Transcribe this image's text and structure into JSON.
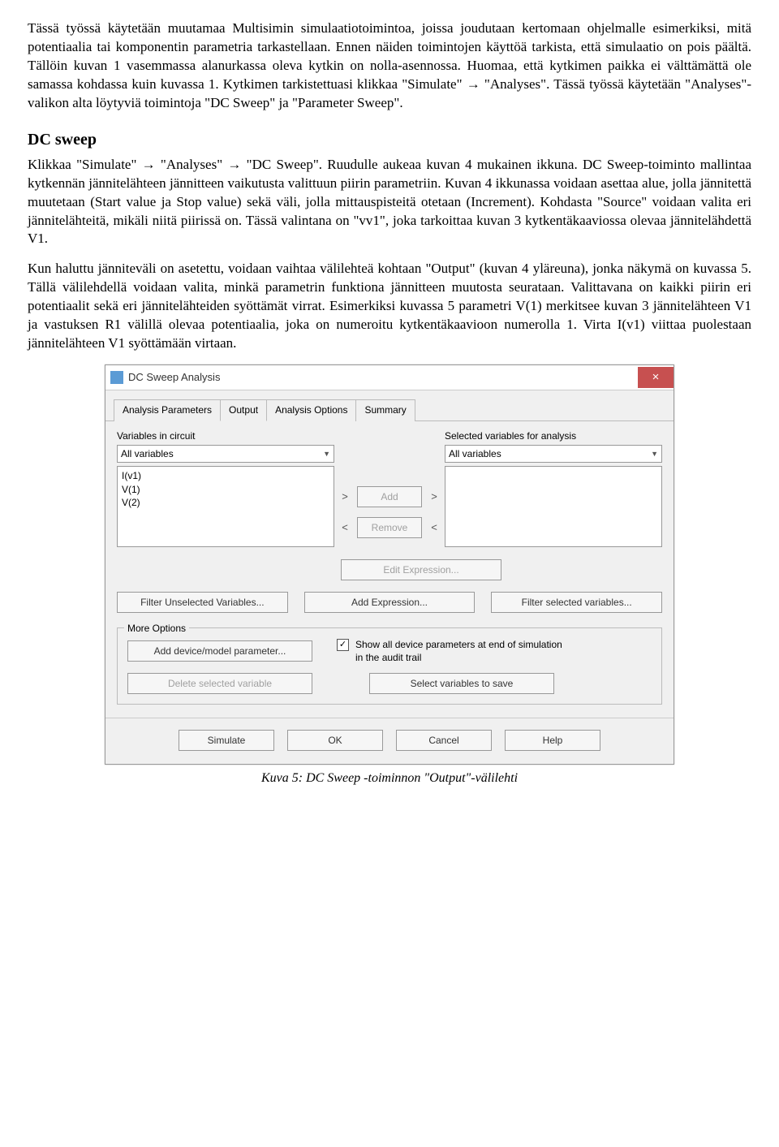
{
  "para1": "Tässä työssä käytetään muutamaa Multisimin simulaatiotoimintoa, joissa joudutaan kertomaan ohjelmalle esimerkiksi, mitä potentiaalia tai komponentin parametria tarkastellaan. Ennen näiden toimintojen käyttöä tarkista, että simulaatio on pois päältä. Tällöin kuvan 1 vasemmassa alanurkassa oleva kytkin on nolla-asennossa. Huomaa, että kytkimen paikka ei välttämättä ole samassa kohdassa kuin kuvassa 1. Kytkimen tarkistettuasi klikkaa \"Simulate\" → \"Analyses\". Tässä työssä käytetään \"Analyses\"-valikon alta löytyviä toimintoja \"DC Sweep\" ja \"Parameter Sweep\".",
  "h_dc": "DC sweep",
  "para2": "Klikkaa \"Simulate\" → \"Analyses\" → \"DC Sweep\". Ruudulle aukeaa kuvan 4 mukainen ikkuna. DC Sweep-toiminto mallintaa kytkennän jännitelähteen jännitteen vaikutusta valittuun piirin parametriin. Kuvan 4 ikkunassa voidaan asettaa alue, jolla jännitettä muutetaan (Start value ja Stop value) sekä väli, jolla mittauspisteitä otetaan (Increment). Kohdasta \"Source\" voidaan valita eri jännitelähteitä, mikäli niitä piirissä on. Tässä valintana on \"vv1\", joka tarkoittaa kuvan 3 kytkentäkaaviossa olevaa jännitelähdettä V1.",
  "para3": "Kun haluttu jänniteväli on asetettu, voidaan vaihtaa välilehteä kohtaan \"Output\" (kuvan 4 yläreuna), jonka näkymä on kuvassa 5. Tällä välilehdellä voidaan valita, minkä parametrin funktiona jännitteen muutosta seurataan. Valittavana on kaikki piirin eri potentiaalit sekä eri jännitelähteiden syöttämät virrat. Esimerkiksi kuvassa 5 parametri V(1) merkitsee kuvan 3 jännitelähteen V1 ja vastuksen R1 välillä olevaa potentiaalia, joka on numeroitu kytkentäkaavioon numerolla 1. Virta I(v1) viittaa puolestaan jännitelähteen V1 syöttämään virtaan.",
  "dialog": {
    "title": "DC Sweep Analysis",
    "tabs": [
      "Analysis Parameters",
      "Output",
      "Analysis Options",
      "Summary"
    ],
    "left_label": "Variables in circuit",
    "right_label": "Selected variables for analysis",
    "select_value": "All variables",
    "listitems": [
      "I(v1)",
      "V(1)",
      "V(2)"
    ],
    "add": "Add",
    "remove": "Remove",
    "editexp": "Edit Expression...",
    "filter_left": "Filter Unselected Variables...",
    "addexp": "Add Expression...",
    "filter_right": "Filter selected variables...",
    "more": "More Options",
    "adddev": "Add device/model parameter...",
    "delsel": "Delete selected variable",
    "checktext": "Show all device parameters at end of simulation in the audit trail",
    "selvars": "Select variables to save",
    "simulate": "Simulate",
    "ok": "OK",
    "cancel": "Cancel",
    "help": "Help"
  },
  "caption": "Kuva 5: DC Sweep -toiminnon \"Output\"-välilehti"
}
